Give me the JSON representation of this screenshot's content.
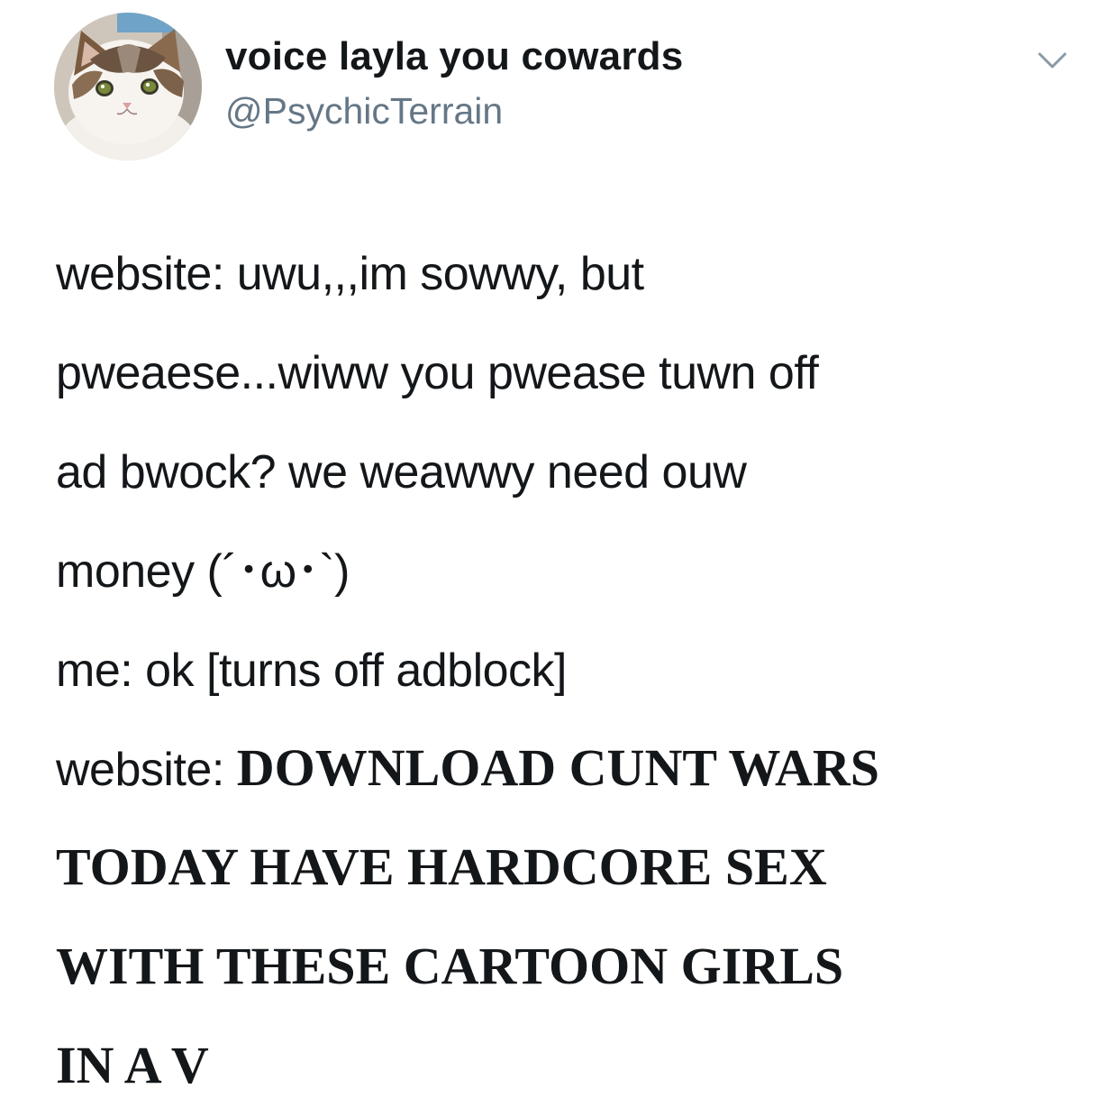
{
  "tweet": {
    "display_name": "voice layla you cowards",
    "handle": "@PsychicTerrain",
    "avatar": "cat-avatar",
    "menu_icon": "chevron-down-icon",
    "lines": [
      {
        "prefix": "website: uwu,,,im sowwy, but",
        "shout": ""
      },
      {
        "prefix": "pweaese...wiww you pwease tuwn off",
        "shout": ""
      },
      {
        "prefix": "ad bwock? we weawwy need ouw",
        "shout": ""
      },
      {
        "prefix": "money (´･ω･`)",
        "shout": ""
      },
      {
        "prefix": "me: ok [turns off adblock]",
        "shout": ""
      },
      {
        "prefix": "website: ",
        "shout": "DOWNLOAD CUNT WARS"
      },
      {
        "prefix": "",
        "shout": "TODAY HAVE HARDCORE SEX"
      },
      {
        "prefix": "",
        "shout": "WITH THESE CARTOON GIRLS"
      },
      {
        "prefix": "",
        "shout": "IN A V"
      }
    ]
  },
  "colors": {
    "text": "#14171a",
    "secondary": "#657786",
    "background": "#ffffff"
  }
}
